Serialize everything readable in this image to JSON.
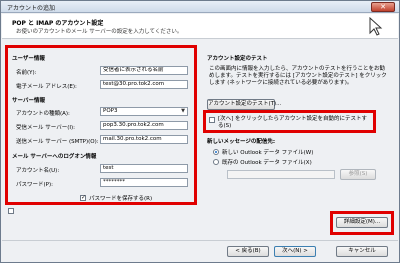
{
  "window": {
    "title": "アカウントの追加",
    "close_glyph": "✕"
  },
  "header": {
    "title": "POP と IMAP のアカウント設定",
    "subtitle": "お使いのアカウントのメール サーバーの設定を入力してください。"
  },
  "user_info": {
    "heading": "ユーザー情報",
    "name_label": "名前(Y):",
    "name_value": "受信者に表示される名前",
    "email_label": "電子メール アドレス(E):",
    "email_value": "test@30.pro.tok2.com"
  },
  "server_info": {
    "heading": "サーバー情報",
    "account_type_label": "アカウントの種類(A):",
    "account_type_value": "POP3",
    "incoming_label": "受信メール サーバー(I):",
    "incoming_value": "pop3.30.pro.tok2.com",
    "outgoing_label": "送信メール サーバー (SMTP)(O):",
    "outgoing_value": "mail.30.pro.tok2.com"
  },
  "logon_info": {
    "heading": "メール サーバーへのログオン情報",
    "account_name_label": "アカウント名(U):",
    "account_name_value": "test",
    "password_label": "パスワード(P):",
    "password_value": "********",
    "remember_password_label": "パスワードを保存する(R)",
    "remember_password_checked": true
  },
  "spa": {
    "label": "",
    "checked": false
  },
  "test_settings": {
    "heading": "アカウント設定のテスト",
    "description": "この画面内に情報を入力したら、アカウントのテストを行うことをお勧めします。テストを実行するには [アカウント設定のテスト] をクリックします (ネットワークに接続されている必要があります)。",
    "test_button_label": "アカウント設定のテスト(T)...",
    "auto_test_label": "[次へ] をクリックしたらアカウント設定を自動的にテストする(S)",
    "auto_test_checked": false
  },
  "delivery": {
    "heading": "新しいメッセージの配信先:",
    "option_new_label": "新しい Outlook データ ファイル(W)",
    "option_existing_label": "既存の Outlook データ ファイル(X)",
    "selected": "new",
    "browse_label": "参照(S)"
  },
  "more_settings_label": "詳細設定(M)...",
  "footer": {
    "back_label": "< 戻る(B)",
    "next_label": "次へ(N) >",
    "cancel_label": "キャンセル"
  },
  "colors": {
    "highlight_box": "#e00000",
    "title_bar": "#cfdbea",
    "dialog_bg": "#eef0f3"
  }
}
